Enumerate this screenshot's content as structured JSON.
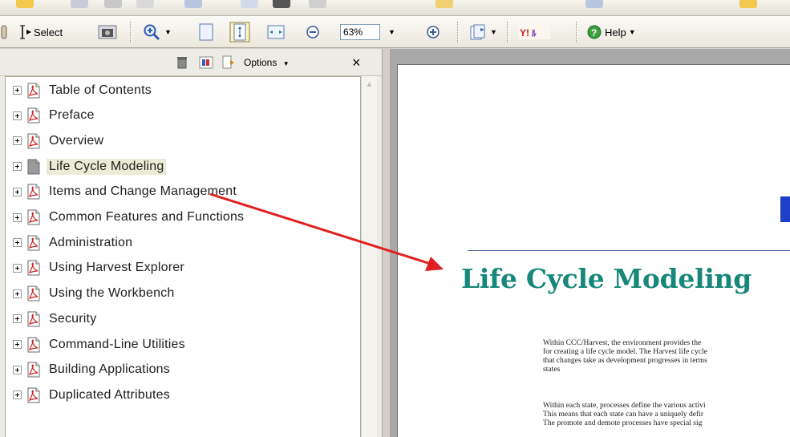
{
  "toolbar": {
    "select_label": "Select",
    "zoom_value": "63%",
    "help_label": "Help",
    "icons": [
      "hand-tool-icon",
      "select-tool-icon",
      "snapshot-icon",
      "zoom-in-tool-icon",
      "fit-page-icon",
      "actual-size-icon",
      "fit-width-icon",
      "zoom-out-icon",
      "zoom-in-icon",
      "page-navigation-icon",
      "yahoo-icon",
      "help-icon"
    ]
  },
  "bookmarks_panel": {
    "options_label": "Options",
    "close_symbol": "×",
    "icons": [
      "delete-bookmark-icon",
      "new-bookmark-icon",
      "expand-bookmark-icon"
    ],
    "items": [
      {
        "label": "Table of Contents"
      },
      {
        "label": "Preface"
      },
      {
        "label": "Overview"
      },
      {
        "label": "Life Cycle Modeling",
        "selected": true
      },
      {
        "label": "Items and Change Management"
      },
      {
        "label": "Common Features and Functions"
      },
      {
        "label": "Administration"
      },
      {
        "label": "Using Harvest Explorer"
      },
      {
        "label": "Using the Workbench"
      },
      {
        "label": "Security"
      },
      {
        "label": "Command-Line Utilities"
      },
      {
        "label": "Building Applications"
      },
      {
        "label": "Duplicated Attributes"
      }
    ]
  },
  "document": {
    "title": "Life Cycle Modeling",
    "paragraph1": [
      "Within CCC/Harvest, the environment provides the",
      "for creating a life cycle model. The Harvest life cycle",
      "that changes take as development progresses in terms",
      "states"
    ],
    "paragraph2": [
      "Within each state, processes define the various activi",
      "This means that each state can have a uniquely defir",
      "The promote and demote processes have special sig"
    ]
  },
  "annotation": {
    "type": "arrow",
    "color": "#e02020"
  },
  "colors": {
    "title": "#17877a",
    "accent_blue": "#1f3fc8",
    "arrow": "#e02020"
  }
}
